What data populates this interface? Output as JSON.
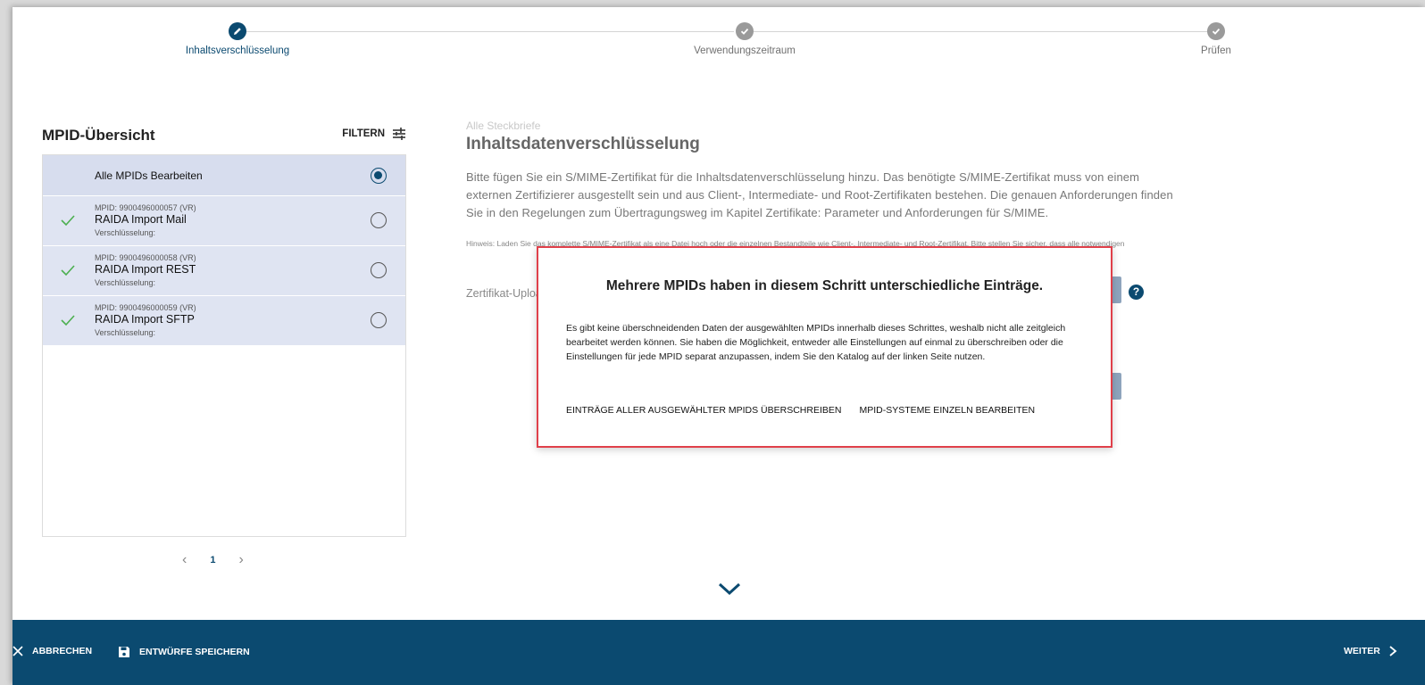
{
  "stepper": {
    "steps": [
      {
        "label": "Inhaltsverschlüsselung",
        "state": "active"
      },
      {
        "label": "Verwendungszeitraum",
        "state": "done"
      },
      {
        "label": "Prüfen",
        "state": "done"
      }
    ]
  },
  "panel": {
    "title": "MPID-Übersicht",
    "filter_label": "FILTERN",
    "all_label": "Alle MPIDs Bearbeiten",
    "items": [
      {
        "mpid": "MPID: 9900496000057 (VR)",
        "name": "RAIDA Import Mail",
        "sub": "Verschlüsselung:"
      },
      {
        "mpid": "MPID: 9900496000058 (VR)",
        "name": "RAIDA Import REST",
        "sub": "Verschlüsselung:"
      },
      {
        "mpid": "MPID: 9900496000059 (VR)",
        "name": "RAIDA Import SFTP",
        "sub": "Verschlüsselung:"
      }
    ],
    "pager": {
      "prev": "‹",
      "page": "1",
      "next": "›"
    }
  },
  "content": {
    "breadcrumb": "Alle Steckbriefe",
    "heading": "Inhaltsdatenverschlüsselung",
    "description": "Bitte fügen Sie ein S/MIME-Zertifikat für die Inhaltsdatenverschlüsselung hinzu. Das benötigte S/MIME-Zertifikat muss von einem externen Zertifizierer ausgestellt sein und aus Client-, Intermediate- und Root-Zertifikaten bestehen. Die genauen Anforderungen finden Sie in den Regelungen zum Übertragungsweg im Kapitel Zertifikate: Parameter und Anforderungen für S/MIME.",
    "hint": "Hinweis: Laden Sie das komplette S/MIME-Zertifikat als eine Datei hoch oder die einzelnen Bestandteile wie Client-, Intermediate- und Root-Zertifikat. Bitte stellen Sie sicher, dass alle notwendigen",
    "upload_label": "Zertifikat-Upload",
    "help": "?"
  },
  "modal": {
    "title": "Mehrere MPIDs haben in diesem Schritt unterschiedliche Einträge.",
    "body": "Es gibt keine überschneidenden Daten der ausgewählten MPIDs innerhalb dieses Schrittes, weshalb nicht alle zeitgleich bearbeitet werden können. Sie haben die Möglichkeit, entweder alle Einstellungen auf einmal zu überschreiben oder die Einstellungen für jede MPID separat anzupassen, indem Sie den Katalog auf der linken Seite nutzen.",
    "overwrite_label": "EINTRÄGE ALLER AUSGEWÄHLTER MPIDS ÜBERSCHREIBEN",
    "individual_label": "MPID-SYSTEME EINZELN BEARBEITEN"
  },
  "footer": {
    "cancel_label": "ABBRECHEN",
    "save_label": "ENTWÜRFE SPEICHERN",
    "next_label": "WEITER"
  },
  "colors": {
    "primary": "#0b4a70",
    "row_bg": "#dfe4f2",
    "modal_border": "#e0404a",
    "check": "#4caf50"
  }
}
